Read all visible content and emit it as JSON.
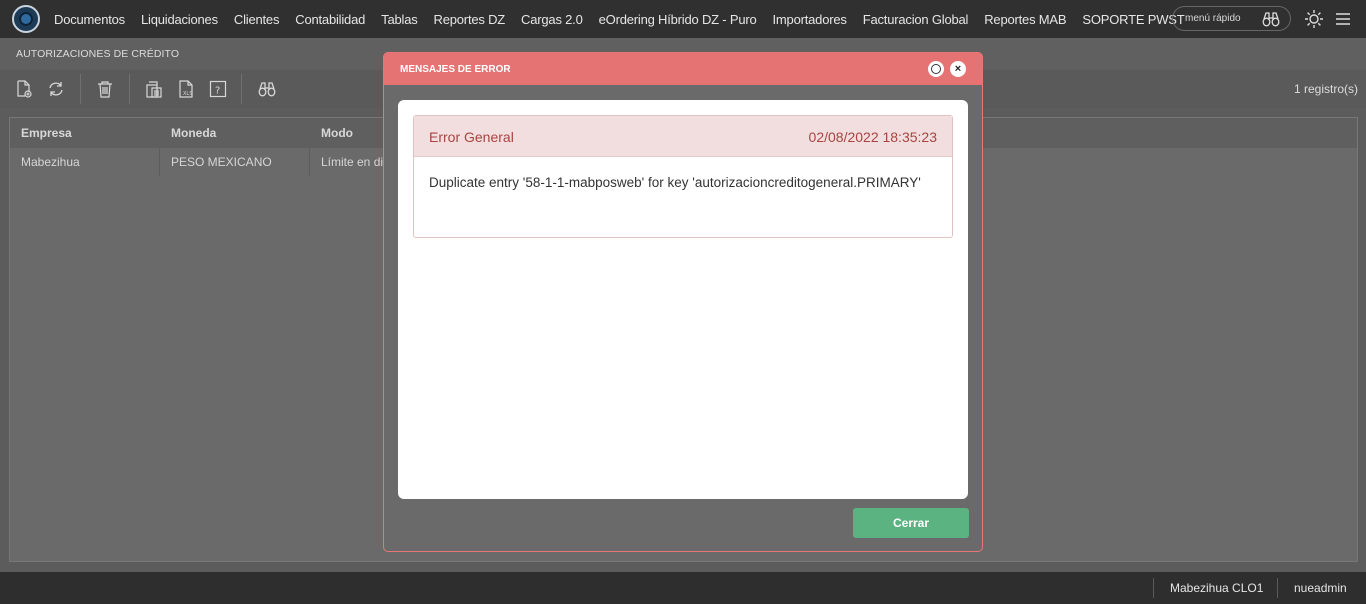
{
  "nav": {
    "items": [
      "Documentos",
      "Liquidaciones",
      "Clientes",
      "Contabilidad",
      "Tablas",
      "Reportes DZ",
      "Cargas 2.0",
      "eOrdering Híbrido DZ - Puro",
      "Importadores",
      "Facturacion Global",
      "Reportes MAB",
      "SOPORTE PWST"
    ],
    "quick_menu_placeholder": "menú rápido"
  },
  "page": {
    "title": "AUTORIZACIONES DE CRÉDITO"
  },
  "toolbar": {
    "record_count": "1 registro(s)"
  },
  "grid": {
    "columns": [
      "Empresa",
      "Moneda",
      "Modo"
    ],
    "rows": [
      [
        "Mabezihua",
        "PESO MEXICANO",
        "Límite en dinero"
      ]
    ]
  },
  "footer": {
    "company": "Mabezihua CLO1",
    "user": "nueadmin"
  },
  "modal": {
    "title": "MENSAJES DE ERROR",
    "error_type": "Error General",
    "error_date": "02/08/2022 18:35:23",
    "error_message": "Duplicate entry '58-1-1-mabposweb' for key 'autorizacioncreditogeneral.PRIMARY'",
    "close_label": "Cerrar"
  },
  "colors": {
    "modal_header": "#e57373",
    "close_button": "#5cb382",
    "error_text": "#a94442"
  }
}
